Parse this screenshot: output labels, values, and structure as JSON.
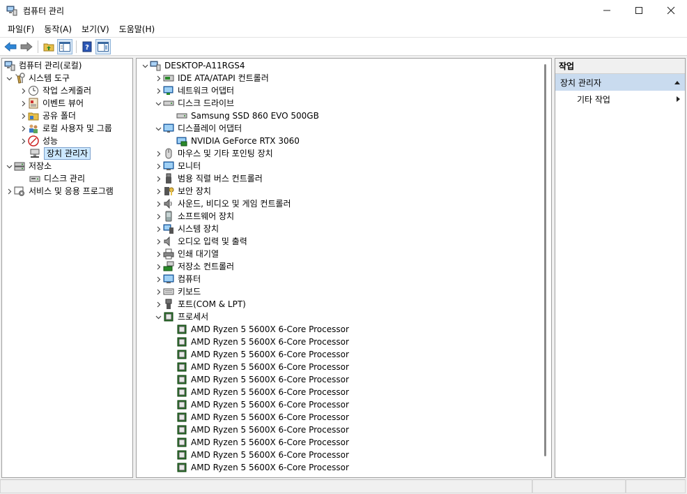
{
  "window": {
    "title": "컴퓨터 관리",
    "minimize": "─",
    "maximize": "☐",
    "close": "✕"
  },
  "menu": [
    "파일(F)",
    "동작(A)",
    "보기(V)",
    "도움말(H)"
  ],
  "left_tree": {
    "root": "컴퓨터 관리(로컬)",
    "system_tools": "시스템 도구",
    "task_scheduler": "작업 스케줄러",
    "event_viewer": "이벤트 뷰어",
    "shared_folders": "공유 폴더",
    "local_users": "로컬 사용자 및 그룹",
    "performance": "성능",
    "device_manager": "장치 관리자",
    "storage": "저장소",
    "disk_management": "디스크 관리",
    "services": "서비스 및 응용 프로그램"
  },
  "device_tree": {
    "computer_name": "DESKTOP-A11RGS4",
    "categories": {
      "ide": "IDE ATA/ATAPI 컨트롤러",
      "network": "네트워크 어댑터",
      "disk": "디스크 드라이브",
      "disk_child": "Samsung SSD 860 EVO 500GB",
      "display": "디스플레이 어댑터",
      "display_child": "NVIDIA GeForce RTX 3060",
      "mouse": "마우스 및 기타 포인팅 장치",
      "monitor": "모니터",
      "usb": "범용 직렬 버스 컨트롤러",
      "security": "보안 장치",
      "sound": "사운드, 비디오 및 게임 컨트롤러",
      "software": "소프트웨어 장치",
      "system": "시스템 장치",
      "audio": "오디오 입력 및 출력",
      "print": "인쇄 대기열",
      "storage_ctrl": "저장소 컨트롤러",
      "computer": "컴퓨터",
      "keyboard": "키보드",
      "ports": "포트(COM & LPT)",
      "processor": "프로세서"
    },
    "processors": [
      "AMD Ryzen 5 5600X 6-Core Processor",
      "AMD Ryzen 5 5600X 6-Core Processor",
      "AMD Ryzen 5 5600X 6-Core Processor",
      "AMD Ryzen 5 5600X 6-Core Processor",
      "AMD Ryzen 5 5600X 6-Core Processor",
      "AMD Ryzen 5 5600X 6-Core Processor",
      "AMD Ryzen 5 5600X 6-Core Processor",
      "AMD Ryzen 5 5600X 6-Core Processor",
      "AMD Ryzen 5 5600X 6-Core Processor",
      "AMD Ryzen 5 5600X 6-Core Processor",
      "AMD Ryzen 5 5600X 6-Core Processor",
      "AMD Ryzen 5 5600X 6-Core Processor"
    ]
  },
  "actions": {
    "header": "작업",
    "section": "장치 관리자",
    "more": "기타 작업"
  },
  "colors": {
    "selection": "#cce8ff",
    "action_section": "#c9dbef",
    "border": "#a0a0a0"
  }
}
